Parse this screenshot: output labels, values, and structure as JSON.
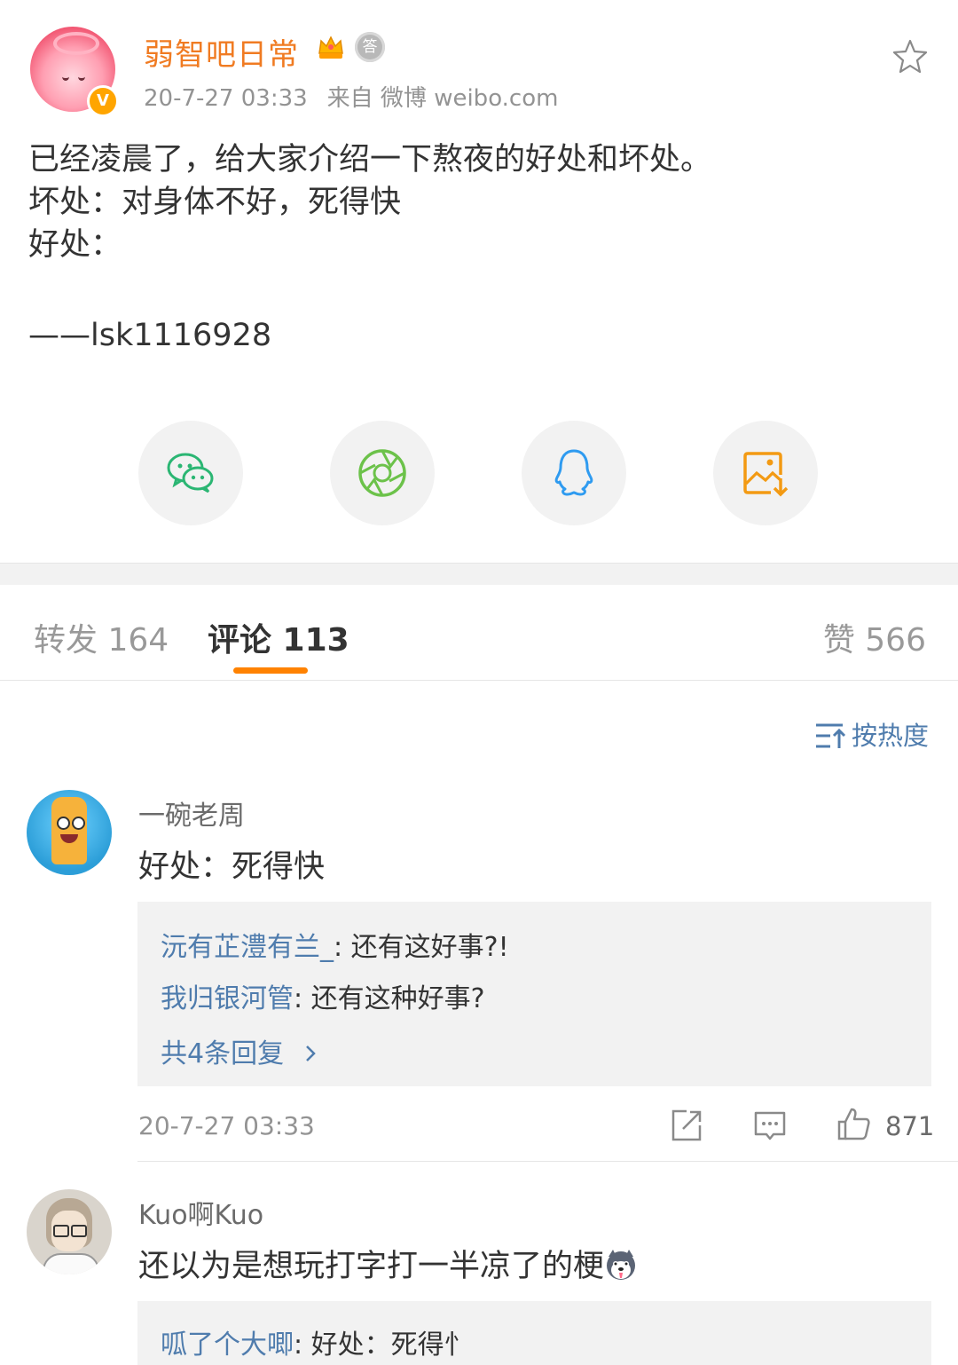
{
  "post": {
    "author": "弱智吧日常",
    "time": "20-7-27 03:33",
    "source": "来自 微博 weibo.com",
    "text": "已经凌晨了，给大家介绍一下熬夜的好处和坏处。\n坏处：对身体不好，死得快\n好处：",
    "signature": "——lsk1116928",
    "medal_char": "答"
  },
  "share": [
    {
      "name": "wechat-icon"
    },
    {
      "name": "moments-icon"
    },
    {
      "name": "qq-icon"
    },
    {
      "name": "save-image-icon"
    }
  ],
  "tabs": {
    "repost": "转发 164",
    "comment": "评论 113",
    "like": "赞 566"
  },
  "sort_label": "按热度",
  "comments": [
    {
      "user": "一碗老周",
      "text": "好处：死得快",
      "replies": [
        {
          "user": "沅有芷澧有兰_",
          "text": ": 还有这好事?!"
        },
        {
          "user": "我归银河管",
          "text": ": 还有这种好事?"
        }
      ],
      "more": "共4条回复",
      "time": "20-7-27 03:33",
      "likes": "871"
    },
    {
      "user": "Kuo啊Kuo",
      "text": "还以为是想玩打字打一半凉了的梗",
      "replies": [
        {
          "user": "呱了个大唧",
          "text": ": 好处：死得忄"
        }
      ]
    }
  ],
  "colors": {
    "accent": "#ff8200",
    "author": "#f07b22",
    "link": "#4f7cad",
    "verified": "#ffa500"
  }
}
